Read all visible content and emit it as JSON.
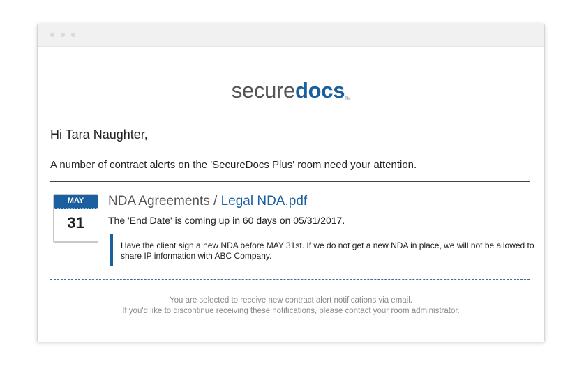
{
  "logo": {
    "part1": "secure",
    "part2": "docs",
    "tm": "TM"
  },
  "greeting": "Hi Tara Naughter,",
  "intro": "A number of contract alerts on the 'SecureDocs Plus' room need your attention.",
  "alert": {
    "calendar": {
      "month": "MAY",
      "day": "31"
    },
    "folder": "NDA Agreements",
    "separator": " / ",
    "file": "Legal NDA.pdf",
    "due": "The 'End Date' is coming up in 60 days on 05/31/2017.",
    "note": "Have the client sign a new NDA before MAY 31st. If we do not get a new NDA in place, we will not be allowed to share IP information with ABC Company."
  },
  "footer": {
    "line1": "You are selected to receive new contract alert notifications via email.",
    "line2": "If you'd like to discontinue receiving these notifications, please contact your room administrator."
  },
  "colors": {
    "accent": "#1a5f9e",
    "text": "#222222",
    "muted": "#8a8a8a"
  }
}
